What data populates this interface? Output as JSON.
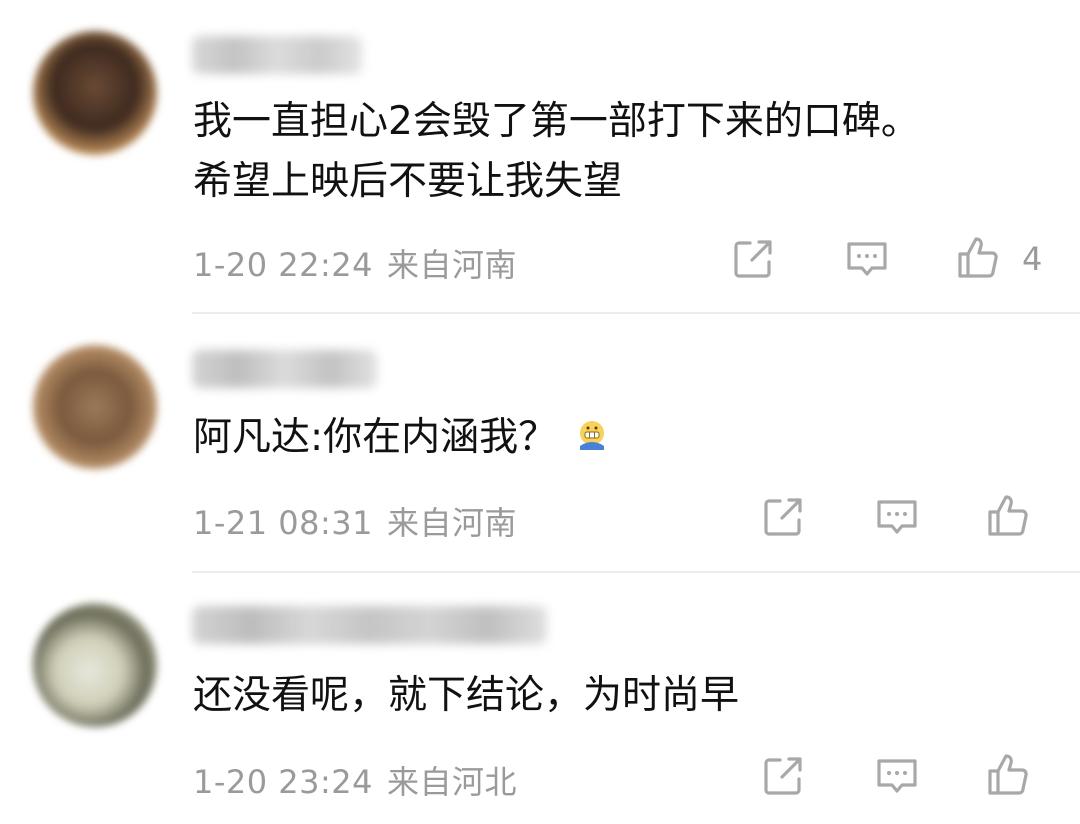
{
  "comments": [
    {
      "text_lines": [
        "我一直担心2会毁了第一部打下来的口碑。",
        "希望上映后不要让我失望"
      ],
      "date": "1-20 22:24",
      "location": "来自河南",
      "like_count": "4"
    },
    {
      "text": "阿凡达:你在内涵我？",
      "emoji": "grimacing-face-emoji",
      "date": "1-21 08:31",
      "location": "来自河南",
      "like_count": ""
    },
    {
      "text": "还没看呢，就下结论，为时尚早",
      "date": "1-20 23:24",
      "location": "来自河北",
      "like_count": ""
    }
  ],
  "icons": {
    "share": "share-icon",
    "reply": "reply-icon",
    "like": "like-icon"
  },
  "colors": {
    "text": "#111111",
    "meta": "#9a9a9a",
    "icon": "#a8a8a8",
    "divider": "#ececec"
  }
}
